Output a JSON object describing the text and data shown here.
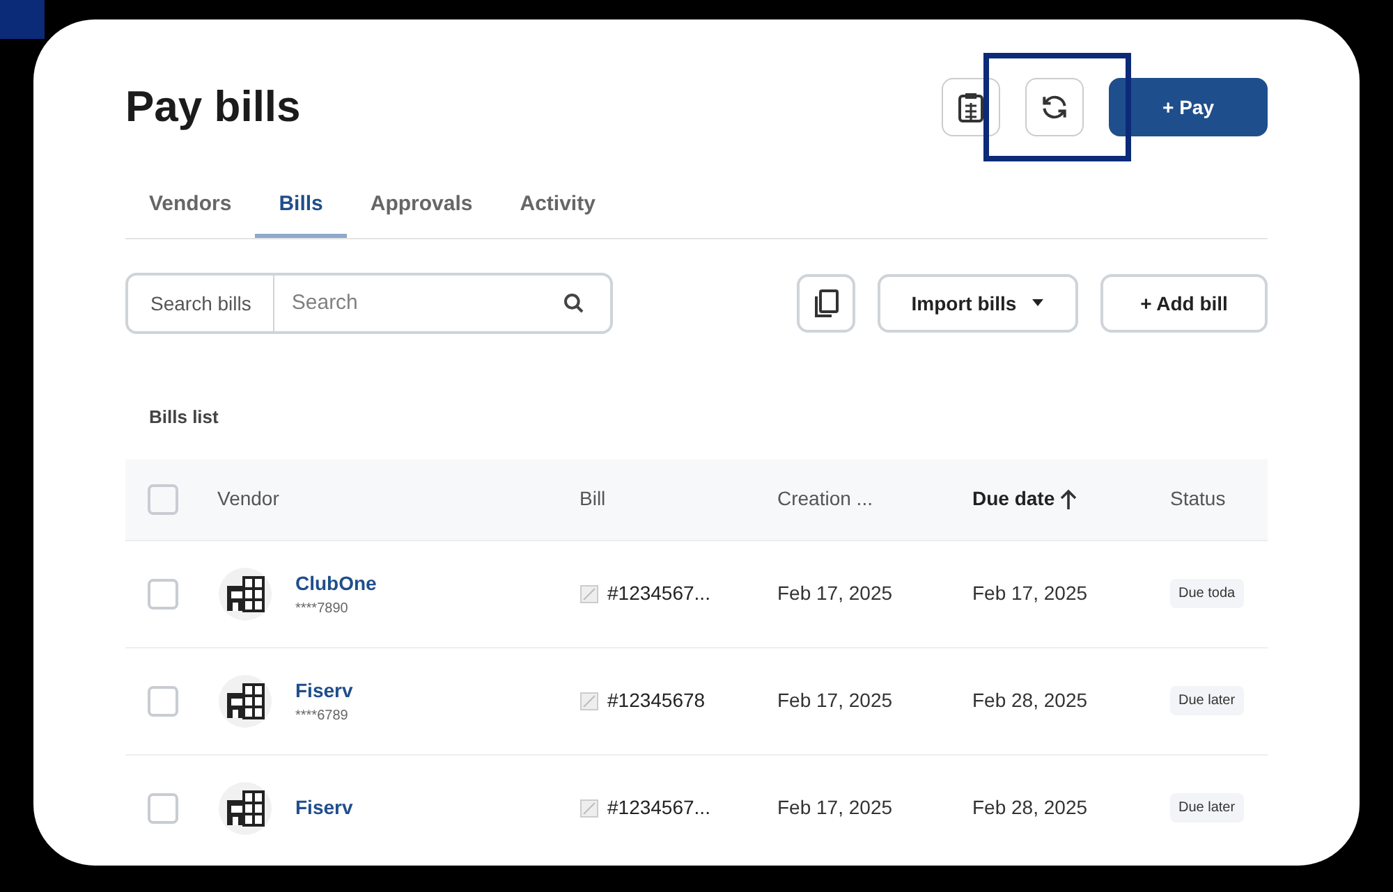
{
  "page": {
    "title": "Pay bills",
    "pay_button": "+ Pay"
  },
  "tabs": [
    {
      "label": "Vendors",
      "selected": false
    },
    {
      "label": "Bills",
      "selected": true
    },
    {
      "label": "Approvals",
      "selected": false
    },
    {
      "label": "Activity",
      "selected": false
    }
  ],
  "search": {
    "label": "Search bills",
    "placeholder": "Search"
  },
  "toolbar": {
    "import": "Import bills",
    "add": "+ Add bill"
  },
  "table": {
    "caption": "Bills list",
    "all_checked": false,
    "columns": [
      "Vendor",
      "Bill",
      "Creation ...",
      "Due date",
      "Status"
    ],
    "rows": [
      {
        "checked": false,
        "vendor": "ClubOne",
        "account": "****7890",
        "bill": "#1234567...",
        "created": "Feb 17, 2025",
        "due": "Feb 17, 2025",
        "status": "Due toda"
      },
      {
        "checked": false,
        "vendor": "Fiserv",
        "account": "****6789",
        "bill": "#12345678",
        "created": "Feb 17, 2025",
        "due": "Feb 28, 2025",
        "status": "Due later"
      },
      {
        "checked": false,
        "vendor": "Fiserv",
        "bill": "#1234567...",
        "created": "Feb 17, 2025",
        "due": "Feb 28, 2025",
        "status": "Due later"
      }
    ]
  }
}
